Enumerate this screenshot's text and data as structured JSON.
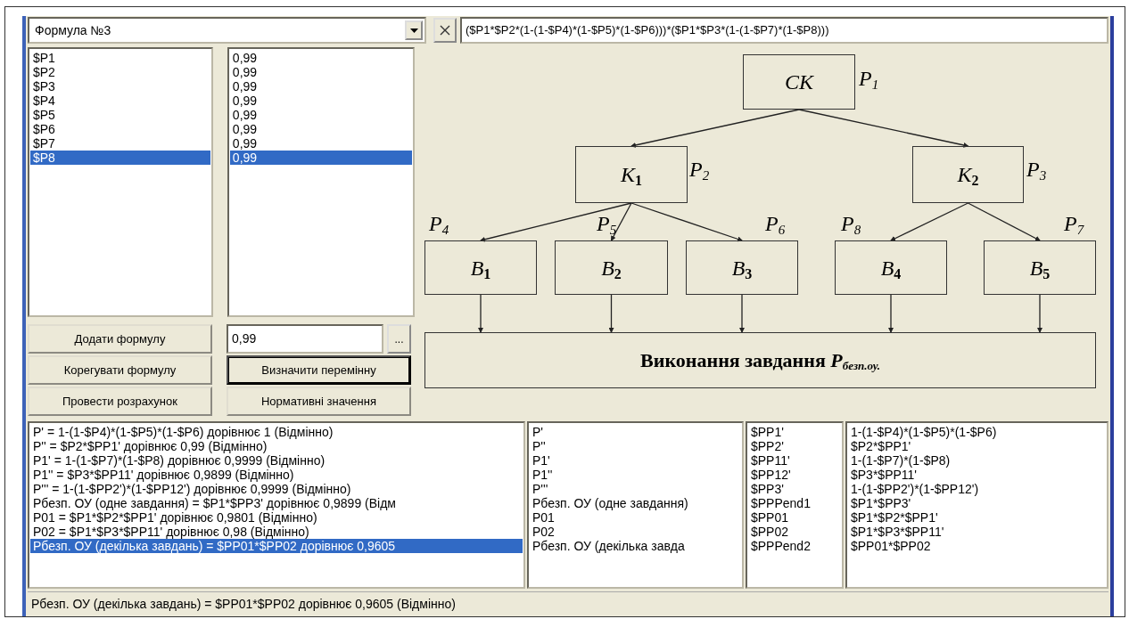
{
  "formula_select": {
    "value": "Формула №3"
  },
  "formula_field": {
    "value": "($P1*$P2*(1-(1-$P4)*(1-$P5)*(1-$P6)))*($P1*$P3*(1-(1-$P7)*(1-$P8)))"
  },
  "variables": [
    {
      "text": "$P1",
      "selected": false
    },
    {
      "text": "$P2",
      "selected": false
    },
    {
      "text": "$P3",
      "selected": false
    },
    {
      "text": "$P4",
      "selected": false
    },
    {
      "text": "$P5",
      "selected": false
    },
    {
      "text": "$P6",
      "selected": false
    },
    {
      "text": "$P7",
      "selected": false
    },
    {
      "text": "$P8",
      "selected": true
    }
  ],
  "values": [
    {
      "text": "0,99",
      "selected": false
    },
    {
      "text": "0,99",
      "selected": false
    },
    {
      "text": "0,99",
      "selected": false
    },
    {
      "text": "0,99",
      "selected": false
    },
    {
      "text": "0,99",
      "selected": false
    },
    {
      "text": "0,99",
      "selected": false
    },
    {
      "text": "0,99",
      "selected": false
    },
    {
      "text": "0,99",
      "selected": true
    }
  ],
  "value_field": {
    "value": "0,99"
  },
  "browse_button": "...",
  "buttons": [
    {
      "label": "Додати формулу",
      "default": false
    },
    {
      "label": "Корегувати формулу",
      "default": false
    },
    {
      "label": "Визначити перемінну",
      "default": true
    },
    {
      "label": "Провести розрахунок",
      "default": false
    },
    {
      "label": "Нормативні значення",
      "default": false
    }
  ],
  "diagram": {
    "root": {
      "label": "CK",
      "probability": "P$_{1}$",
      "children": [
        {
          "label": "K$_{1}$",
          "probability": "P$_{2}$",
          "children": [
            {
              "label": "B$_{1}$",
              "probability": "P$_{4}$"
            },
            {
              "label": "B$_{2}$",
              "probability": "P$_{5}$"
            },
            {
              "label": "B$_{3}$",
              "probability": "P$_{6}$"
            }
          ]
        },
        {
          "label": "K$_{2}$",
          "probability": "P$_{3}$",
          "children": [
            {
              "label": "B$_{4}$",
              "probability": "P$_{8}$"
            },
            {
              "label": "B$_{5}$",
              "probability": "P$_{7}$"
            }
          ]
        }
      ]
    },
    "outcome": "Виконання завдання *P*$_{безп.оу.}$"
  },
  "results": [
    [
      {
        "text": "P' = 1-(1-$P4)*(1-$P5)*(1-$P6) дорівнює 1 (Відмінно)",
        "selected": false
      },
      {
        "text": "P'' = $P2*$PP1' дорівнює 0,99 (Відмінно)",
        "selected": false
      },
      {
        "text": "P1' = 1-(1-$P7)*(1-$P8) дорівнює 0,9999 (Відмінно)",
        "selected": false
      },
      {
        "text": "P1'' = $P3*$PP11' дорівнює 0,9899 (Відмінно)",
        "selected": false
      },
      {
        "text": "P''' = 1-(1-$PP2')*(1-$PP12') дорівнює 0,9999 (Відмінно)",
        "selected": false
      },
      {
        "text": "Рбезп. ОУ (одне завдання) = $P1*$PP3' дорівнює 0,9899 (Відм",
        "selected": false
      },
      {
        "text": "P01 = $P1*$P2*$PP1' дорівнює 0,9801 (Відмінно)",
        "selected": false
      },
      {
        "text": "P02 = $P1*$P3*$PP11' дорівнює 0,98 (Відмінно)",
        "selected": false
      },
      {
        "text": "Рбезп. ОУ (декілька завдань) = $PP01*$PP02 дорівнює 0,9605",
        "selected": true
      }
    ],
    [
      {
        "text": "P'",
        "selected": false
      },
      {
        "text": "P''",
        "selected": false
      },
      {
        "text": "P1'",
        "selected": false
      },
      {
        "text": "P1''",
        "selected": false
      },
      {
        "text": "P'''",
        "selected": false
      },
      {
        "text": "Рбезп. ОУ (одне завдання)",
        "selected": false
      },
      {
        "text": "P01",
        "selected": false
      },
      {
        "text": "P02",
        "selected": false
      },
      {
        "text": "Рбезп. ОУ (декілька завда",
        "selected": false
      }
    ],
    [
      {
        "text": "$PP1'",
        "selected": false
      },
      {
        "text": "$PP2'",
        "selected": false
      },
      {
        "text": "$PP11'",
        "selected": false
      },
      {
        "text": "$PP12'",
        "selected": false
      },
      {
        "text": "$PP3'",
        "selected": false
      },
      {
        "text": "$PPPend1",
        "selected": false
      },
      {
        "text": "$PP01",
        "selected": false
      },
      {
        "text": "$PP02",
        "selected": false
      },
      {
        "text": "$PPPend2",
        "selected": false
      }
    ],
    [
      {
        "text": "1-(1-$P4)*(1-$P5)*(1-$P6)",
        "selected": false
      },
      {
        "text": "$P2*$PP1'",
        "selected": false
      },
      {
        "text": "1-(1-$P7)*(1-$P8)",
        "selected": false
      },
      {
        "text": "$P3*$PP11'",
        "selected": false
      },
      {
        "text": "1-(1-$PP2')*(1-$PP12')",
        "selected": false
      },
      {
        "text": "$P1*$PP3'",
        "selected": false
      },
      {
        "text": "$P1*$P2*$PP1'",
        "selected": false
      },
      {
        "text": "$P1*$P3*$PP11'",
        "selected": false
      },
      {
        "text": "$PP01*$PP02",
        "selected": false
      }
    ]
  ],
  "status_bar": "Рбезп. ОУ (декілька завдань) = $PP01*$PP02 дорівнює 0,9605 (Відмінно)"
}
